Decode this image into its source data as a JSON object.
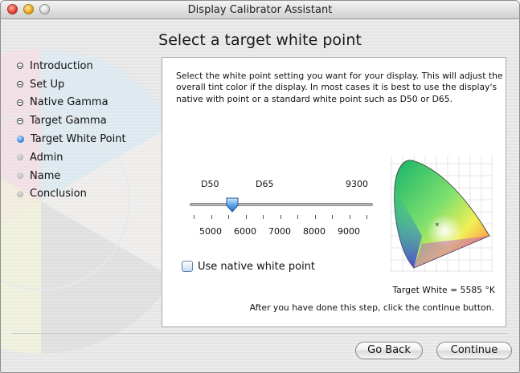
{
  "window": {
    "title": "Display Calibrator Assistant"
  },
  "heading": "Select a target white point",
  "steps": [
    {
      "label": "Introduction",
      "state": "done"
    },
    {
      "label": "Set Up",
      "state": "done"
    },
    {
      "label": "Native Gamma",
      "state": "done"
    },
    {
      "label": "Target Gamma",
      "state": "done"
    },
    {
      "label": "Target White Point",
      "state": "current"
    },
    {
      "label": "Admin",
      "state": "pending"
    },
    {
      "label": "Name",
      "state": "pending"
    },
    {
      "label": "Conclusion",
      "state": "pending"
    }
  ],
  "instructions": "Select the white point setting you want for your display.  This will adjust the overall tint color if the display.  In most cases it is best to use the display's native with point or a standard white point such as D50 or D65.",
  "slider": {
    "top_labels": [
      "D50",
      "D65",
      "9300"
    ],
    "bottom_labels": [
      "5000",
      "6000",
      "7000",
      "8000",
      "9000"
    ],
    "value": 5585
  },
  "checkbox": {
    "label": "Use native white point",
    "checked": false
  },
  "target_white_text": "Target White = 5585 °K",
  "after_text": "After you have done this step, click the continue button.",
  "buttons": {
    "back": "Go Back",
    "continue": "Continue"
  },
  "colors": {
    "current_step_bullet": "#2f7be0",
    "panel_background": "#ffffff"
  }
}
